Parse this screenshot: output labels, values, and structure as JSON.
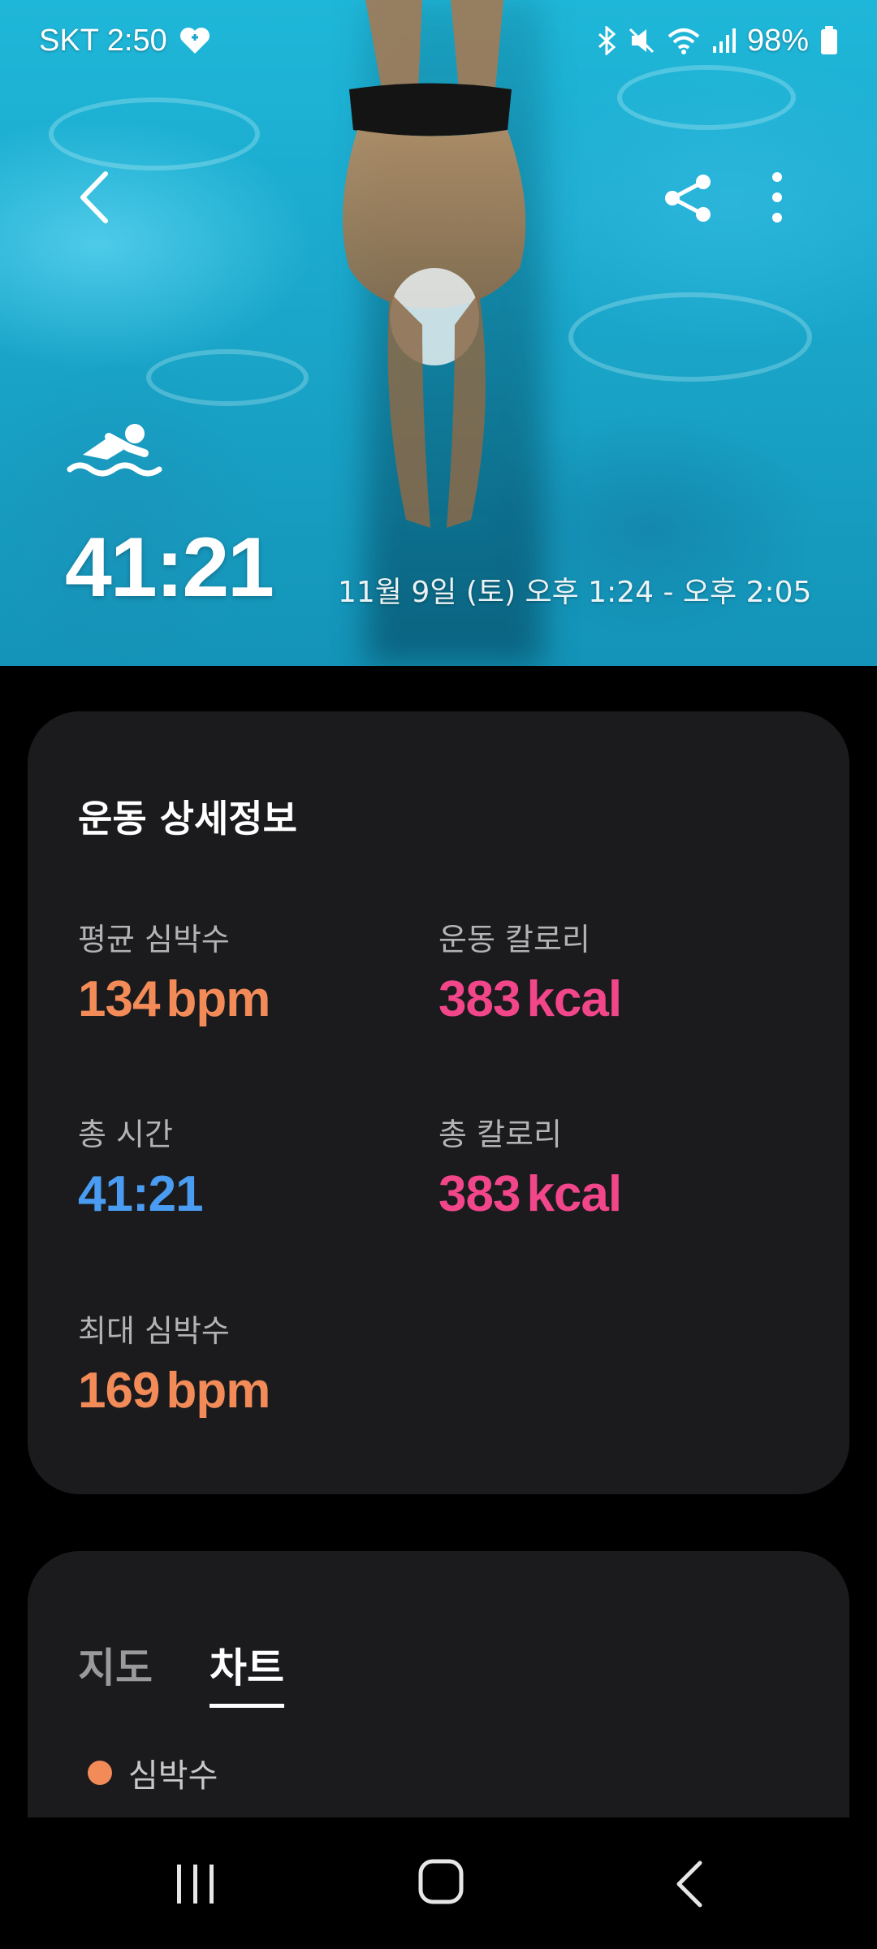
{
  "status_bar": {
    "carrier_time": "SKT 2:50",
    "battery": "98%",
    "icons": [
      "heart-plus-icon",
      "bluetooth-icon",
      "mute-icon",
      "wifi-icon",
      "signal-icon",
      "battery-icon"
    ]
  },
  "hero": {
    "activity_icon": "swimming-icon",
    "duration": "41:21",
    "date_range": "11월 9일 (토) 오후 1:24 - 오후 2:05",
    "actions": [
      "back-icon",
      "share-icon",
      "more-vertical-icon"
    ]
  },
  "details": {
    "title": "운동 상세정보",
    "stats": [
      {
        "label": "평균 심박수",
        "value": "134",
        "unit": "bpm",
        "color": "#f28b58"
      },
      {
        "label": "운동 칼로리",
        "value": "383",
        "unit": "kcal",
        "color": "#f2468a"
      },
      {
        "label": "총 시간",
        "value": "41:21",
        "unit": "",
        "color": "#4a9cf2"
      },
      {
        "label": "총 칼로리",
        "value": "383",
        "unit": "kcal",
        "color": "#f2468a"
      },
      {
        "label": "최대 심박수",
        "value": "169",
        "unit": "bpm",
        "color": "#f28b58"
      }
    ]
  },
  "chart_section": {
    "tabs": [
      {
        "label": "지도",
        "active": false
      },
      {
        "label": "차트",
        "active": true
      }
    ],
    "legend": {
      "label": "심박수",
      "color": "#f28b58"
    }
  },
  "nav_bar": {
    "buttons": [
      "recents-icon",
      "home-icon",
      "back-icon"
    ]
  }
}
